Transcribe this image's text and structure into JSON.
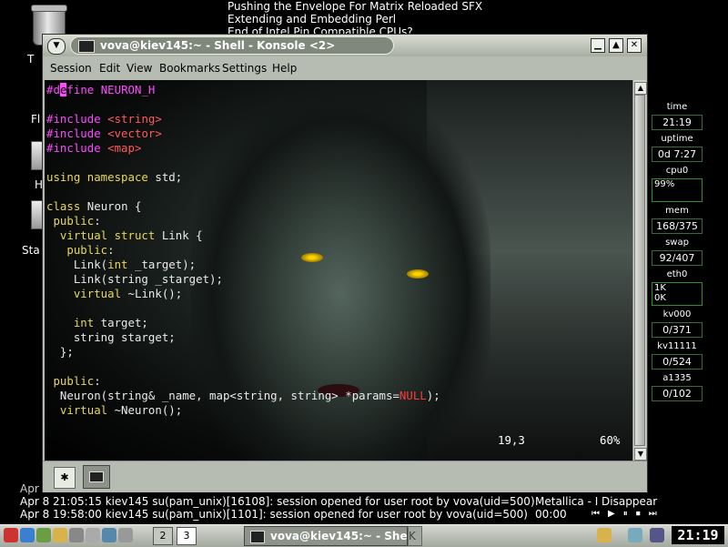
{
  "news": [
    "Pushing the Envelope For Matrix Reloaded SFX",
    "Extending and Embedding Perl",
    "End of Intel Pin Compatible CPUs?"
  ],
  "desktop_labels": [
    "T",
    "Fl",
    "H",
    "Sta"
  ],
  "window": {
    "title": "vova@kiev145:~ - Shell - Konsole <2>",
    "menu": [
      "Session",
      "Edit",
      "View",
      "Bookmarks",
      "Settings",
      "Help"
    ],
    "status_pos": "19,3",
    "status_pct": "60%",
    "new_tab_icon": "new-session-icon",
    "tab_icon": "terminal-icon"
  },
  "code_lines": [
    [
      {
        "t": "#",
        "c": "pp"
      },
      {
        "t": "d",
        "c": "pp"
      },
      {
        "t": "e",
        "c": "cursor"
      },
      {
        "t": "fine NEURON_H",
        "c": "pp"
      }
    ],
    [],
    [
      {
        "t": "#include ",
        "c": "pp"
      },
      {
        "t": "<string>",
        "c": "inc"
      }
    ],
    [
      {
        "t": "#include ",
        "c": "pp"
      },
      {
        "t": "<vector>",
        "c": "inc"
      }
    ],
    [
      {
        "t": "#include ",
        "c": "pp"
      },
      {
        "t": "<map>",
        "c": "inc"
      }
    ],
    [],
    [
      {
        "t": "using namespace",
        "c": "kw"
      },
      {
        "t": " std;",
        "c": ""
      }
    ],
    [],
    [
      {
        "t": "class",
        "c": "kw"
      },
      {
        "t": " Neuron {",
        "c": ""
      }
    ],
    [
      {
        "t": " public",
        "c": "kw"
      },
      {
        "t": ":",
        "c": ""
      }
    ],
    [
      {
        "t": "  virtual struct",
        "c": "kw"
      },
      {
        "t": " Link {",
        "c": ""
      }
    ],
    [
      {
        "t": "   public",
        "c": "kw"
      },
      {
        "t": ":",
        "c": ""
      }
    ],
    [
      {
        "t": "    Link(",
        "c": ""
      },
      {
        "t": "int",
        "c": "kw"
      },
      {
        "t": " _target);",
        "c": ""
      }
    ],
    [
      {
        "t": "    Link(string _starget);",
        "c": ""
      }
    ],
    [
      {
        "t": "    virtual",
        "c": "kw"
      },
      {
        "t": " ~Link();",
        "c": ""
      }
    ],
    [],
    [
      {
        "t": "    int",
        "c": "kw"
      },
      {
        "t": " target;",
        "c": ""
      }
    ],
    [
      {
        "t": "    string starget;",
        "c": ""
      }
    ],
    [
      {
        "t": "  };",
        "c": ""
      }
    ],
    [],
    [
      {
        "t": " public",
        "c": "kw"
      },
      {
        "t": ":",
        "c": ""
      }
    ],
    [
      {
        "t": "  Neuron(string& _name, map<string, string> *params=",
        "c": ""
      },
      {
        "t": "NULL",
        "c": "red"
      },
      {
        "t": ");",
        "c": ""
      }
    ],
    [
      {
        "t": "  virtual",
        "c": "kw"
      },
      {
        "t": " ~Neuron();",
        "c": ""
      }
    ]
  ],
  "monitor": {
    "time_label": "time",
    "time": "21:19",
    "uptime_label": "uptime",
    "uptime": "0d 7:27",
    "cpu_label": "cpu0",
    "cpu": "99%",
    "mem_label": "mem",
    "mem": "168/375",
    "swap_label": "swap",
    "swap": "92/407",
    "eth_label": "eth0",
    "eth_in": "1K",
    "eth_out": "0K",
    "kv000_label": "kv000",
    "kv000": "0/371",
    "kv11111_label": "kv11111",
    "kv11111": "0/524",
    "a1335_label": "a1335",
    "a1335": "0/102"
  },
  "log": {
    "partial": "Apr",
    "line1": "Apr  8 21:05:15 kiev145 su(pam_unix)[16108]: session opened for user root by vova(uid=500)",
    "line2": "Apr  8 19:58:00 kiev145 su(pam_unix)[1101]: session opened for user root by vova(uid=500)"
  },
  "now_playing": {
    "track": "Metallica - I Disappear",
    "time": "00:00",
    "controls": "⏮▶⏸⏹⏭"
  },
  "taskbar": {
    "pager": [
      "2",
      "3"
    ],
    "task_label": "vova@kiev145:~ - Shell - Konsole",
    "task2_label": "K",
    "clock": "21:19"
  },
  "colors": {
    "keyword": "#e8d75a",
    "preprocessor": "#ff4aff",
    "include": "#ff5a5a",
    "null": "#ff3a3a"
  }
}
